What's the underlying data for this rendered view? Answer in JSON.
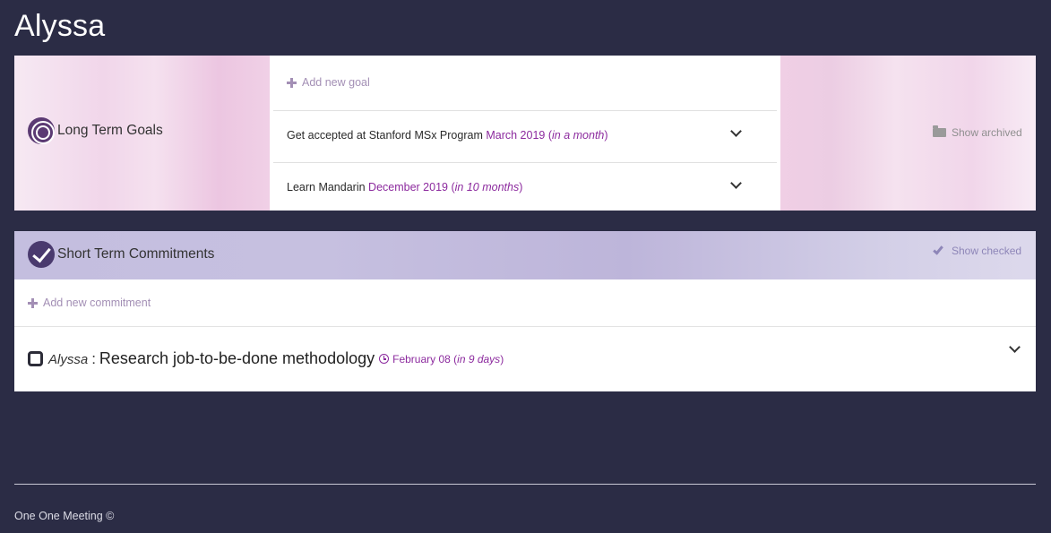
{
  "page": {
    "title": "Alyssa"
  },
  "long_term_goals": {
    "heading": "Long Term Goals",
    "add_label": "Add new goal",
    "show_archived_label": "Show archived",
    "goals": [
      {
        "title": "Get accepted at Stanford MSx Program",
        "date": "March 2019",
        "relative": "in a month"
      },
      {
        "title": "Learn Mandarin",
        "date": "December 2019",
        "relative": "in 10 months"
      }
    ]
  },
  "short_term_commitments": {
    "heading": "Short Term Commitments",
    "add_label": "Add new commitment",
    "show_checked_label": "Show checked",
    "items": [
      {
        "owner": "Alyssa",
        "separator": ":",
        "title": "Research job-to-be-done methodology",
        "date": "February 08",
        "relative": "in 9 days",
        "checked": false
      }
    ]
  },
  "footer": {
    "text": "One One Meeting ©"
  },
  "colors": {
    "background": "#2b2c45",
    "date_accent": "#8c2a9e",
    "add_link": "#a38fb5"
  },
  "icons": [
    "target-icon",
    "plus-icon",
    "chevron-down-icon",
    "folder-open-icon",
    "check-circle-icon",
    "check-icon",
    "clock-icon"
  ]
}
